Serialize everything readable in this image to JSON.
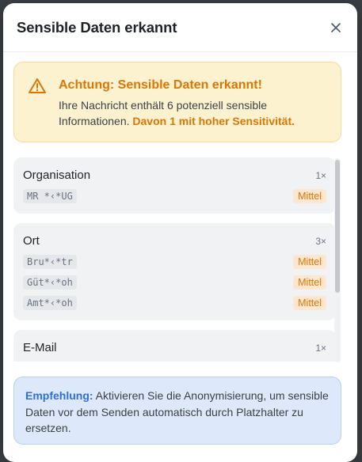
{
  "dialog": {
    "title": "Sensible Daten erkannt",
    "close_icon": "close-icon"
  },
  "warning": {
    "icon": "warning-triangle-icon",
    "title": "Achtung: Sensible Daten erkannt!",
    "text": "Ihre Nachricht enthält 6 potenziell sensible Informationen.",
    "highlight": "Davon 1 mit hoher Sensitivität.",
    "accent": "#d97706"
  },
  "categories": [
    {
      "name": "Organisation",
      "count": "1×",
      "items": [
        {
          "masked": "MR *‹*UG",
          "level": "Mittel"
        }
      ]
    },
    {
      "name": "Ort",
      "count": "3×",
      "items": [
        {
          "masked": "Bru*‹*tr",
          "level": "Mittel"
        },
        {
          "masked": "Güt*‹*oh",
          "level": "Mittel"
        },
        {
          "masked": "Amt*‹*oh",
          "level": "Mittel"
        }
      ]
    },
    {
      "name": "E-Mail",
      "count": "1×",
      "items": []
    }
  ],
  "recommendation": {
    "lead": "Empfehlung:",
    "text": "Aktivieren Sie die Anonymisierung, um sensible Daten vor dem Senden automatisch durch Platzhalter zu ersetzen.",
    "accent": "#2f6fd8"
  }
}
